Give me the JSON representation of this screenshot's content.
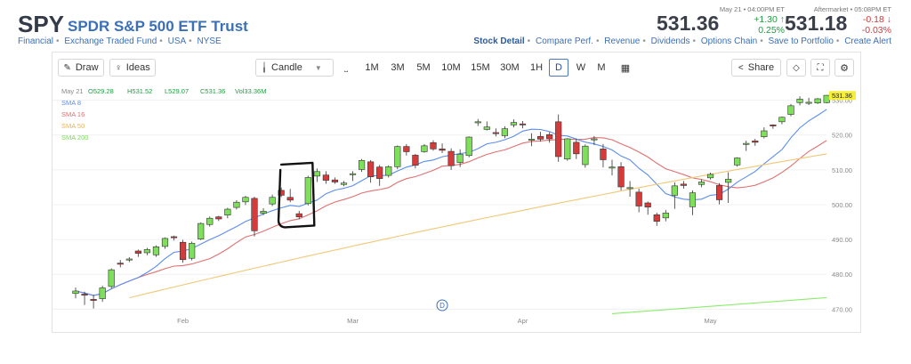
{
  "header": {
    "ticker": "SPY",
    "name": "SPDR S&P 500 ETF Trust",
    "meta": [
      "Financial",
      "Exchange Traded Fund",
      "USA",
      "NYSE"
    ]
  },
  "quote": {
    "regular": {
      "time": "May 21 • 04:00PM ET",
      "price": "531.36",
      "change": "+1.30 ↑",
      "percent": "0.25%"
    },
    "after": {
      "time": "Aftermarket • 05:08PM ET",
      "price": "531.18",
      "change": "-0.18 ↓",
      "percent": "-0.03%"
    }
  },
  "links": [
    "Stock Detail",
    "Compare Perf.",
    "Revenue",
    "Dividends",
    "Options Chain",
    "Save to Portfolio",
    "Create Alert"
  ],
  "toolbar": {
    "draw": "Draw",
    "ideas": "Ideas",
    "chart_type": "Candle",
    "timeframes": [
      "1M",
      "3M",
      "5M",
      "10M",
      "15M",
      "30M",
      "1H",
      "D",
      "W",
      "M"
    ],
    "selected_timeframe": "D",
    "share": "Share"
  },
  "colors": {
    "up": "#7ee05a",
    "down": "#d63b3b",
    "sma8": "#5b8def",
    "sma16": "#e07070",
    "sma50": "#f0c878",
    "sma200": "#8cec6c",
    "price_tag": "#f5ef3a",
    "link": "#3b6fb6"
  },
  "chart_data": {
    "type": "candlestick",
    "ohlc_label": {
      "date": "May 21",
      "open": "O529.28",
      "high": "H531.52",
      "low": "L529.07",
      "close": "C531.36",
      "volume": "Vol33.36M"
    },
    "legend": [
      "SMA 8",
      "SMA 16",
      "SMA 50",
      "SMA 200"
    ],
    "last_price_tag": "531.36",
    "y_ticks": [
      470,
      480,
      490,
      500,
      510,
      520,
      530
    ],
    "y_tick_labels": [
      "470.00",
      "480.00",
      "490.00",
      "500.00",
      "510.00",
      "520.00",
      "530.00"
    ],
    "ylim": [
      466,
      535
    ],
    "x_labels": [
      {
        "label": "Feb",
        "index": 12
      },
      {
        "label": "Mar",
        "index": 31
      },
      {
        "label": "Apr",
        "index": 50
      },
      {
        "label": "May",
        "index": 71
      }
    ],
    "event_marker": {
      "label": "D",
      "index": 41
    },
    "candles": [
      [
        474.5,
        476.2,
        473.1,
        475.2
      ],
      [
        474.3,
        475.0,
        471.2,
        474.1
      ],
      [
        472.8,
        474.1,
        470.2,
        472.5
      ],
      [
        473.0,
        476.7,
        472.1,
        476.1
      ],
      [
        476.5,
        481.7,
        476.0,
        481.3
      ],
      [
        483.2,
        484.1,
        482.0,
        482.9
      ],
      [
        484.4,
        484.9,
        483.5,
        484.4
      ],
      [
        486.7,
        487.1,
        485.0,
        486.0
      ],
      [
        486.2,
        487.6,
        485.5,
        487.1
      ],
      [
        485.6,
        488.3,
        485.0,
        487.9
      ],
      [
        488.0,
        490.6,
        487.3,
        490.3
      ],
      [
        490.8,
        491.1,
        489.7,
        490.6
      ],
      [
        489.2,
        489.9,
        483.3,
        484.2
      ],
      [
        484.6,
        489.4,
        484.0,
        488.9
      ],
      [
        490.1,
        494.9,
        489.8,
        494.6
      ],
      [
        494.3,
        496.6,
        493.7,
        496.1
      ],
      [
        496.5,
        496.8,
        495.3,
        495.9
      ],
      [
        497.0,
        499.1,
        496.1,
        498.7
      ],
      [
        499.2,
        501.3,
        498.6,
        500.7
      ],
      [
        500.8,
        502.5,
        499.9,
        502.1
      ],
      [
        501.8,
        502.3,
        490.9,
        492.5
      ],
      [
        497.5,
        499.0,
        497.0,
        498.1
      ],
      [
        500.2,
        502.9,
        499.6,
        502.1
      ],
      [
        504.1,
        504.9,
        502.2,
        502.7
      ],
      [
        502.1,
        504.5,
        500.7,
        501.3
      ],
      [
        497.4,
        498.2,
        495.8,
        496.5
      ],
      [
        500.3,
        508.3,
        499.8,
        507.8
      ],
      [
        508.2,
        510.4,
        506.5,
        509.5
      ],
      [
        508.5,
        509.6,
        506.0,
        507.0
      ],
      [
        507.1,
        507.8,
        506.0,
        506.5
      ],
      [
        505.8,
        506.8,
        505.3,
        506.2
      ],
      [
        508.6,
        509.6,
        506.8,
        508.9
      ],
      [
        510.1,
        513.1,
        509.4,
        512.7
      ],
      [
        512.3,
        512.8,
        506.3,
        508.0
      ],
      [
        510.8,
        511.4,
        505.4,
        507.5
      ],
      [
        508.4,
        511.3,
        507.8,
        510.9
      ],
      [
        510.9,
        517.0,
        510.2,
        516.7
      ],
      [
        516.7,
        517.4,
        514.1,
        515.2
      ],
      [
        514.2,
        514.6,
        510.4,
        511.3
      ],
      [
        515.2,
        517.4,
        514.9,
        516.9
      ],
      [
        517.8,
        518.5,
        515.5,
        516.0
      ],
      [
        516.0,
        517.6,
        514.8,
        515.6
      ],
      [
        515.3,
        516.2,
        510.0,
        511.2
      ],
      [
        512.1,
        515.9,
        510.8,
        514.5
      ],
      [
        514.1,
        519.6,
        513.6,
        519.4
      ],
      [
        523.8,
        524.6,
        522.6,
        523.8
      ],
      [
        521.6,
        523.9,
        521.3,
        522.3
      ],
      [
        520.7,
        521.9,
        519.6,
        520.5
      ],
      [
        519.8,
        522.5,
        519.1,
        521.8
      ],
      [
        522.9,
        524.5,
        522.2,
        523.6
      ],
      [
        523.2,
        524.0,
        521.9,
        523.1
      ],
      [
        518.7,
        520.5,
        516.8,
        518.8
      ],
      [
        519.6,
        520.9,
        518.1,
        518.8
      ],
      [
        520.1,
        520.8,
        517.8,
        518.9
      ],
      [
        523.8,
        525.9,
        512.3,
        513.8
      ],
      [
        513.1,
        519.1,
        512.6,
        518.9
      ],
      [
        517.9,
        519.0,
        513.1,
        514.6
      ],
      [
        511.5,
        517.3,
        510.6,
        516.8
      ],
      [
        518.7,
        519.7,
        517.1,
        518.9
      ],
      [
        516.0,
        517.4,
        510.7,
        512.9
      ],
      [
        510.6,
        512.9,
        508.4,
        510.8
      ],
      [
        510.9,
        512.2,
        504.1,
        505.1
      ],
      [
        504.9,
        506.8,
        502.3,
        504.9
      ],
      [
        503.6,
        504.6,
        497.8,
        499.6
      ],
      [
        500.5,
        500.9,
        497.1,
        499.3
      ],
      [
        497.1,
        497.7,
        493.9,
        495.2
      ],
      [
        496.2,
        498.5,
        495.2,
        497.6
      ],
      [
        502.7,
        506.4,
        498.8,
        505.4
      ],
      [
        505.9,
        506.8,
        504.6,
        505.5
      ],
      [
        499.4,
        504.1,
        497.0,
        503.4
      ],
      [
        505.8,
        507.2,
        505.0,
        506.5
      ],
      [
        507.7,
        509.2,
        507.2,
        508.7
      ],
      [
        505.5,
        506.2,
        500.1,
        501.4
      ],
      [
        506.4,
        509.3,
        500.5,
        507.3
      ],
      [
        511.4,
        513.6,
        510.9,
        513.4
      ],
      [
        517.3,
        518.4,
        515.4,
        517.6
      ],
      [
        518.3,
        518.9,
        516.9,
        517.9
      ],
      [
        519.5,
        522.2,
        519.0,
        521.2
      ],
      [
        522.9,
        523.1,
        521.8,
        522.7
      ],
      [
        523.8,
        525.3,
        523.1,
        525.1
      ],
      [
        525.9,
        528.9,
        525.4,
        528.4
      ],
      [
        529.3,
        531.1,
        528.5,
        530.3
      ],
      [
        529.4,
        530.7,
        528.6,
        529.4
      ],
      [
        529.2,
        530.6,
        528.9,
        530.4
      ],
      [
        529.3,
        531.5,
        529.1,
        531.4
      ]
    ]
  }
}
